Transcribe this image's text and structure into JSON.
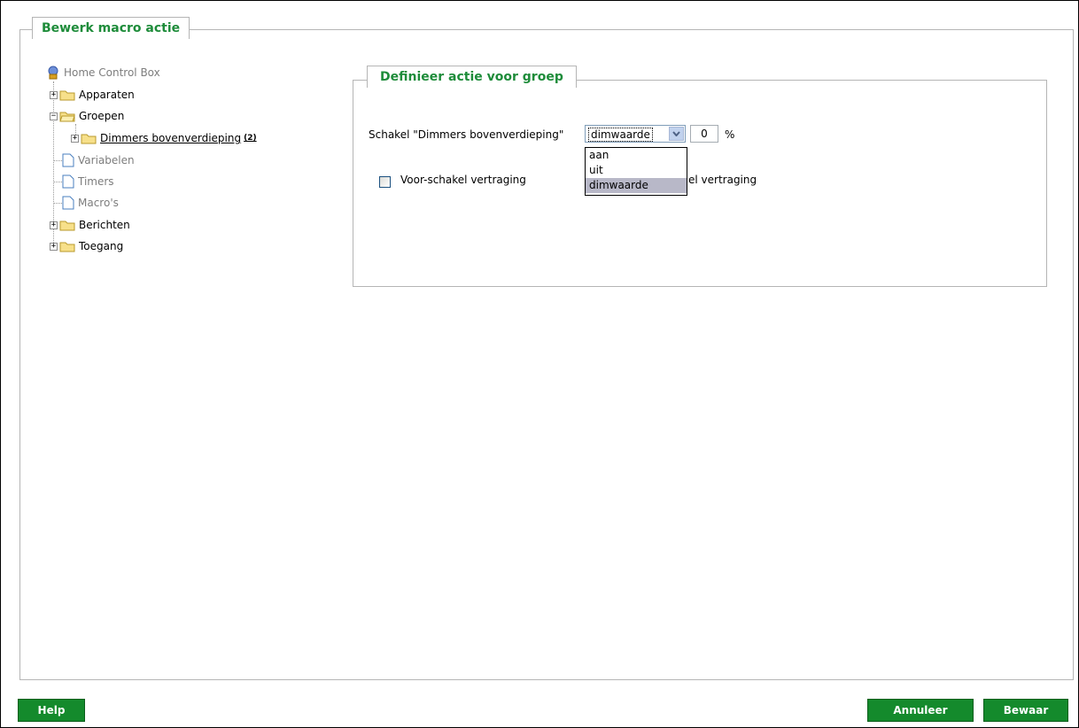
{
  "panel": {
    "title": "Bewerk macro actie"
  },
  "tree": {
    "root": "Home Control Box",
    "items": [
      {
        "label": "Apparaten"
      },
      {
        "label": "Groepen"
      },
      {
        "label": "Dimmers bovenverdieping",
        "count": "(2)"
      },
      {
        "label": "Variabelen"
      },
      {
        "label": "Timers"
      },
      {
        "label": "Macro's"
      },
      {
        "label": "Berichten"
      },
      {
        "label": "Toegang"
      }
    ]
  },
  "group": {
    "title": "Definieer actie voor groep",
    "action_label": "Schakel \"Dimmers bovenverdieping\"",
    "select_value": "dimwaarde",
    "options": [
      "aan",
      "uit",
      "dimwaarde"
    ],
    "percent_value": "0",
    "percent_unit": "%",
    "pre_delay_label": "Voor-schakel vertraging",
    "post_delay_label_visible": "el vertraging"
  },
  "buttons": {
    "help": "Help",
    "cancel": "Annuleer",
    "save": "Bewaar"
  },
  "colors": {
    "accent": "#1e8c3a",
    "button_bg": "#148a2c"
  }
}
